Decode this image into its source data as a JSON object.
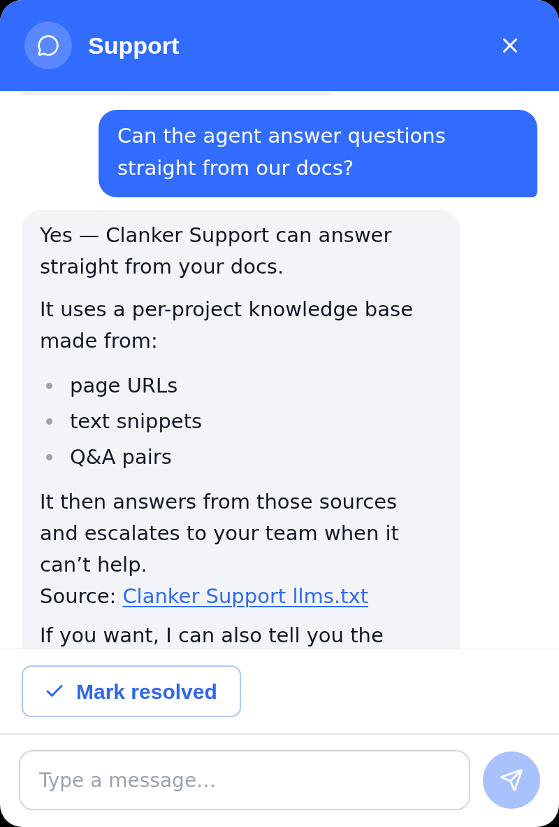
{
  "header": {
    "title": "Support"
  },
  "messages": [
    {
      "kind": "user",
      "text": "Can the agent answer questions straight from our docs?"
    },
    {
      "kind": "assistant",
      "blocks": [
        {
          "kind": "paragraph",
          "text": "Yes — Clanker Support can answer straight from your docs."
        },
        {
          "kind": "paragraph",
          "text": "It uses a per-project knowledge base made from:"
        },
        {
          "kind": "list",
          "items": [
            "page URLs",
            "text snippets",
            "Q&A pairs"
          ]
        },
        {
          "kind": "paragraph",
          "text": "It then answers from those sources and escalates to your team when it can’t help.",
          "source": {
            "label": "Source:",
            "link": "Clanker Support llms.txt"
          }
        },
        {
          "kind": "paragraph",
          "text": "If you want, I can also tell you the"
        }
      ]
    }
  ],
  "actions": {
    "mark_resolved": "Mark resolved"
  },
  "composer": {
    "placeholder": "Type a message…",
    "send_disabled": true
  }
}
